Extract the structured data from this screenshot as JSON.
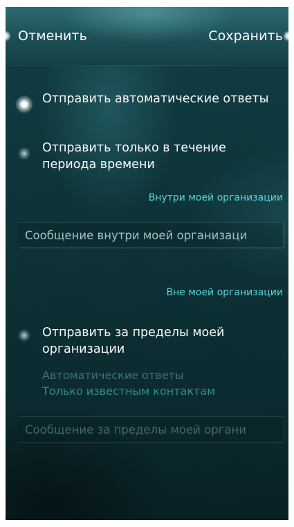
{
  "header": {
    "cancel_label": "Отменить",
    "save_label": "Сохранить"
  },
  "options": {
    "auto_reply_label": "Отправить автоматические ответы",
    "auto_reply_selected": true,
    "time_period_label": "Отправить только в течение периода времени",
    "time_period_selected": false
  },
  "inside_org": {
    "section_label": "Внутри моей организации",
    "message_placeholder": "Сообщение внутри моей организаци",
    "message_value": ""
  },
  "outside_org": {
    "section_label": "Вне моей организации",
    "send_outside_label": "Отправить за пределы моей организации",
    "send_outside_selected": false,
    "auto_replies_title": "Автоматические ответы",
    "auto_replies_value": "Только известным контактам",
    "message_placeholder": "Сообщение за пределы моей органи",
    "message_value": ""
  },
  "colors": {
    "accent": "#5fd6dc",
    "background": "#0c3338",
    "text": "#ffffff"
  }
}
